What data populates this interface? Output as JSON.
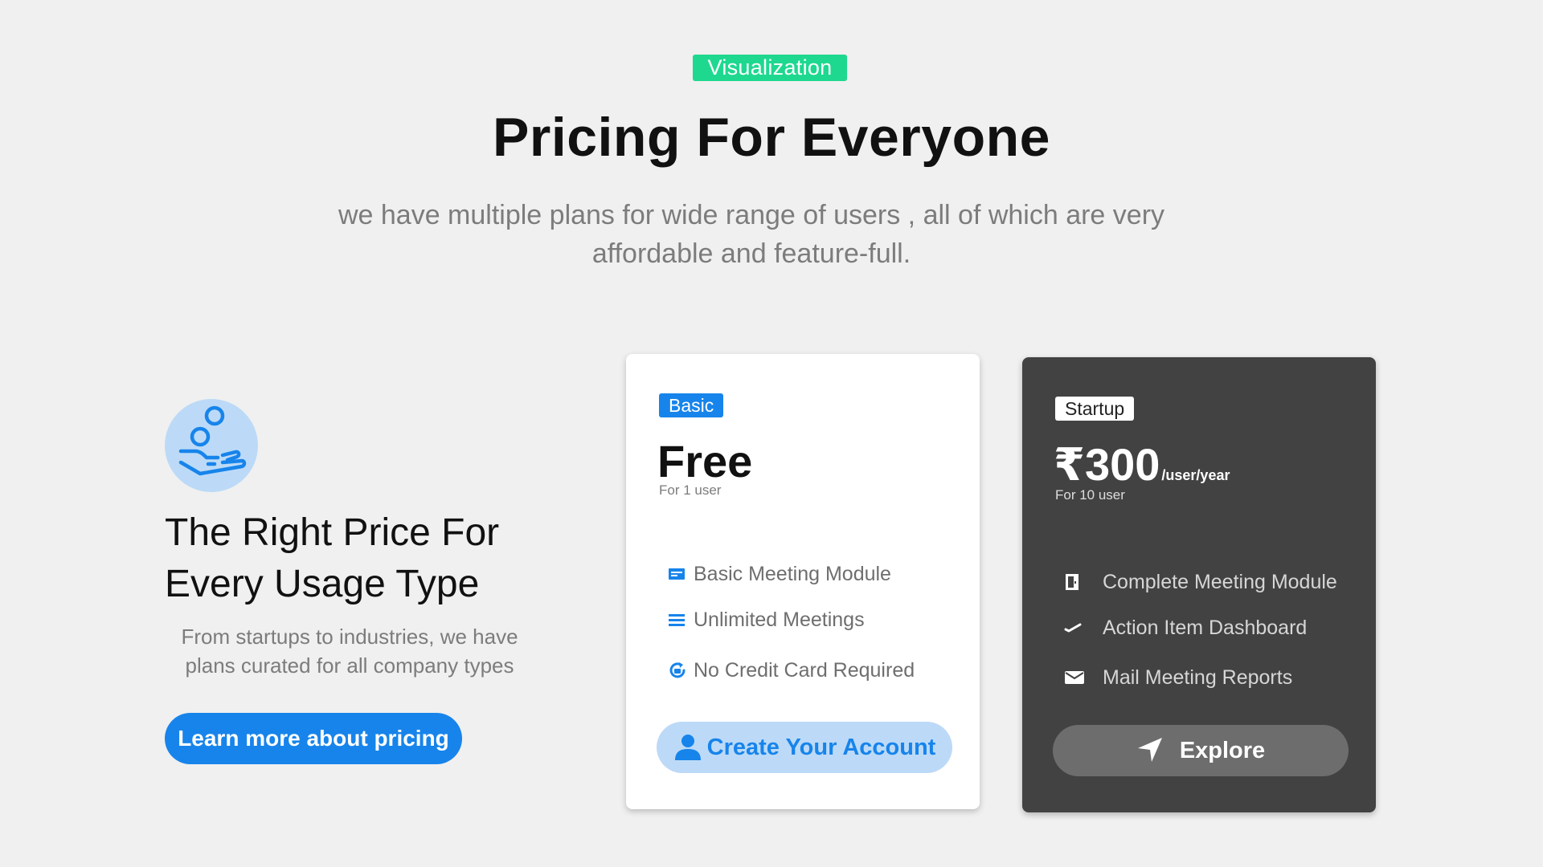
{
  "header": {
    "badge": "Visualization",
    "title": "Pricing For Everyone",
    "subtitle": "we have multiple plans for  wide range of users , all of which are very affordable and feature-full."
  },
  "intro": {
    "icon": "hand-coins-icon",
    "heading": "The Right Price For Every Usage Type",
    "description": "From startups to industries, we have plans curated for all company types",
    "button_label": "Learn more about pricing"
  },
  "plans": [
    {
      "tag": "Basic",
      "price": "Free",
      "period": "",
      "users": "For 1 user",
      "features": [
        {
          "icon": "module-icon",
          "label": "Basic Meeting Module"
        },
        {
          "icon": "list-icon",
          "label": "Unlimited Meetings"
        },
        {
          "icon": "card-refresh-icon",
          "label": "No Credit Card Required"
        }
      ],
      "button_label": "Create Your Account",
      "button_icon": "user-icon"
    },
    {
      "tag": "Startup",
      "price": "₹300",
      "period": "/user/year",
      "users": "For 10 user",
      "features": [
        {
          "icon": "door-icon",
          "label": "Complete Meeting Module"
        },
        {
          "icon": "check-icon",
          "label": "Action Item Dashboard"
        },
        {
          "icon": "mail-icon",
          "label": "Mail Meeting Reports"
        }
      ],
      "button_label": "Explore",
      "button_icon": "navigation-arrow-icon"
    }
  ],
  "colors": {
    "background": "#f0f0f0",
    "badge_green": "#1ed88f",
    "primary_blue": "#1784eb",
    "light_blue": "#bcdaf7",
    "dark_card": "#424242",
    "explore_button": "#6d6d6d"
  }
}
